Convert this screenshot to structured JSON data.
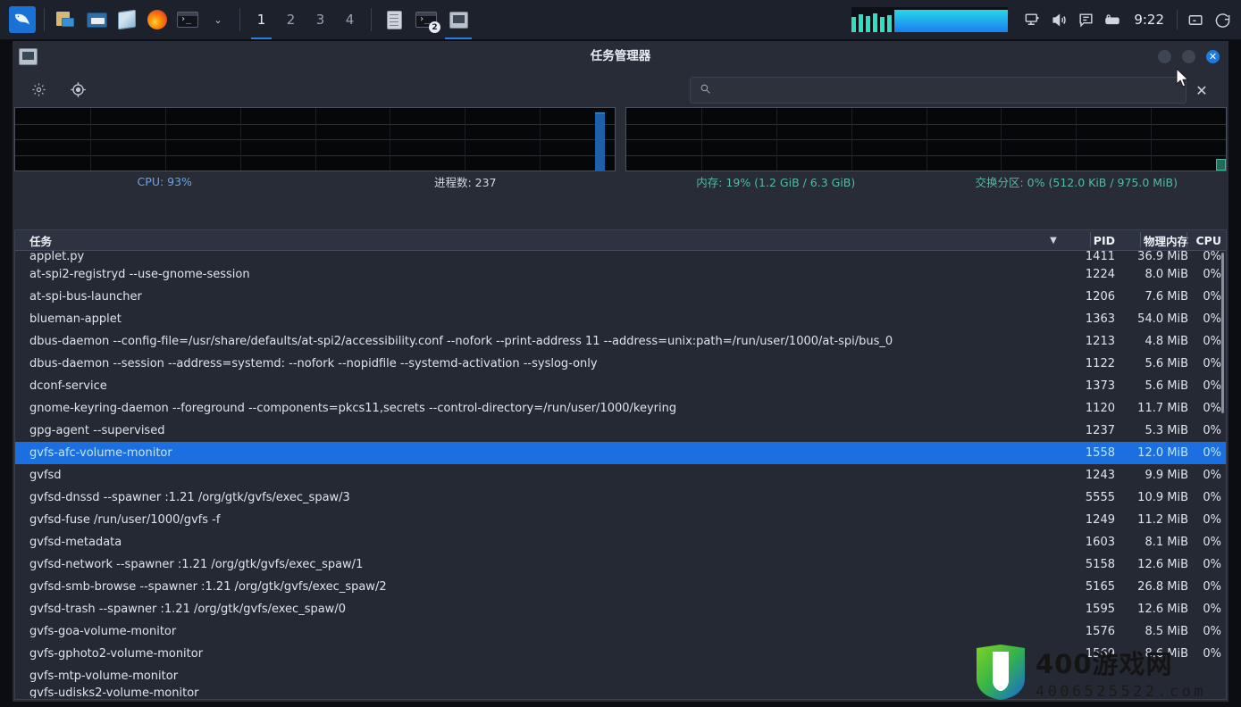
{
  "taskbar": {
    "launcher": {
      "name": "kali-menu",
      "label": ""
    },
    "pinned": [
      {
        "icon": "files-split-icon",
        "label": ""
      },
      {
        "icon": "folder-icon",
        "label": ""
      },
      {
        "icon": "notes-app-icon",
        "label": ""
      },
      {
        "icon": "firefox-icon",
        "label": ""
      },
      {
        "icon": "terminal-icon",
        "label": ""
      }
    ],
    "dropdown_caret": "⌄",
    "desktops": [
      {
        "label": "1",
        "active": true
      },
      {
        "label": "2",
        "active": false
      },
      {
        "label": "3",
        "active": false
      },
      {
        "label": "4",
        "active": false
      }
    ],
    "tasks": [
      {
        "icon": "text-editor-icon",
        "badge": "",
        "active": false
      },
      {
        "icon": "terminal-window-icon",
        "badge": "2",
        "active": false
      },
      {
        "icon": "task-manager-icon",
        "badge": "",
        "active": true
      }
    ],
    "tray": [
      {
        "icon": "display-icon"
      },
      {
        "icon": "volume-icon"
      },
      {
        "icon": "chat-icon"
      },
      {
        "icon": "keyboard-icon"
      }
    ],
    "clock": "9:22",
    "tray_right": [
      {
        "icon": "screen-lock-icon"
      },
      {
        "icon": "power-icon"
      }
    ],
    "cpu_widget_name": "cpu-monitor-widget"
  },
  "window": {
    "title": "任务管理器",
    "icon": "task-manager-icon",
    "buttons": {
      "minimize": "",
      "maximize": "",
      "close": "✕"
    },
    "toolbar": {
      "settings_icon": "gear-icon",
      "target_icon": "crosshair-icon"
    },
    "search": {
      "icon": "search-icon",
      "value": "",
      "placeholder": "",
      "clear_label": "✕"
    }
  },
  "stats": {
    "cpu_label": "CPU: 93%",
    "process_label": "进程数: 237",
    "memory_label": "内存: 19% (1.2 GiB / 6.3 GiB)",
    "swap_label": "交换分区: 0% (512.0 KiB / 975.0 MiB)"
  },
  "chart_data": [
    {
      "type": "area",
      "title": "CPU",
      "ylabel": "%",
      "ylim": [
        0,
        100
      ],
      "grid": true,
      "series": [
        {
          "name": "CPU",
          "color": "#1d5fa8",
          "values": [
            0,
            0,
            0,
            0,
            0,
            0,
            0,
            0,
            0,
            0,
            0,
            0,
            0,
            0,
            0,
            0,
            0,
            0,
            0,
            0,
            0,
            0,
            0,
            0,
            0,
            0,
            0,
            0,
            0,
            0,
            0,
            0,
            0,
            0,
            0,
            0,
            0,
            0,
            0,
            0,
            0,
            0,
            0,
            0,
            0,
            0,
            0,
            0,
            0,
            0,
            0,
            0,
            0,
            0,
            0,
            0,
            0,
            0,
            0,
            93,
            0
          ]
        }
      ],
      "annotation": "CPU: 93%"
    },
    {
      "type": "area",
      "title": "内存",
      "ylabel": "%",
      "ylim": [
        0,
        100
      ],
      "grid": true,
      "series": [
        {
          "name": "内存",
          "color": "#1f6b5c",
          "values": [
            0,
            0,
            0,
            0,
            0,
            0,
            0,
            0,
            0,
            0,
            0,
            0,
            0,
            0,
            0,
            0,
            0,
            0,
            0,
            0,
            0,
            0,
            0,
            0,
            0,
            0,
            0,
            0,
            0,
            0,
            0,
            0,
            0,
            0,
            0,
            0,
            0,
            0,
            0,
            0,
            0,
            0,
            0,
            0,
            0,
            0,
            0,
            0,
            0,
            0,
            0,
            0,
            0,
            0,
            0,
            0,
            0,
            0,
            0,
            0,
            19
          ]
        }
      ],
      "annotation": "内存: 19% (1.2 GiB / 6.3 GiB)"
    }
  ],
  "table": {
    "headers": {
      "task": "任务",
      "sort_icon": "▼",
      "pid": "PID",
      "memory": "物理内存",
      "cpu": "CPU"
    },
    "rows": [
      {
        "task": "applet.py",
        "pid": "1411",
        "mem": "36.9 MiB",
        "cpu": "0%",
        "selected": false,
        "clipped": "top"
      },
      {
        "task": "at-spi2-registryd --use-gnome-session",
        "pid": "1224",
        "mem": "8.0 MiB",
        "cpu": "0%",
        "selected": false
      },
      {
        "task": "at-spi-bus-launcher",
        "pid": "1206",
        "mem": "7.6 MiB",
        "cpu": "0%",
        "selected": false
      },
      {
        "task": "blueman-applet",
        "pid": "1363",
        "mem": "54.0 MiB",
        "cpu": "0%",
        "selected": false
      },
      {
        "task": "dbus-daemon --config-file=/usr/share/defaults/at-spi2/accessibility.conf --nofork --print-address 11 --address=unix:path=/run/user/1000/at-spi/bus_0",
        "pid": "1213",
        "mem": "4.8 MiB",
        "cpu": "0%",
        "selected": false
      },
      {
        "task": "dbus-daemon --session --address=systemd: --nofork --nopidfile --systemd-activation --syslog-only",
        "pid": "1122",
        "mem": "5.6 MiB",
        "cpu": "0%",
        "selected": false
      },
      {
        "task": "dconf-service",
        "pid": "1373",
        "mem": "5.6 MiB",
        "cpu": "0%",
        "selected": false
      },
      {
        "task": "gnome-keyring-daemon --foreground --components=pkcs11,secrets --control-directory=/run/user/1000/keyring",
        "pid": "1120",
        "mem": "11.7 MiB",
        "cpu": "0%",
        "selected": false
      },
      {
        "task": "gpg-agent --supervised",
        "pid": "1237",
        "mem": "5.3 MiB",
        "cpu": "0%",
        "selected": false
      },
      {
        "task": "gvfs-afc-volume-monitor",
        "pid": "1558",
        "mem": "12.0 MiB",
        "cpu": "0%",
        "selected": true
      },
      {
        "task": "gvfsd",
        "pid": "1243",
        "mem": "9.9 MiB",
        "cpu": "0%",
        "selected": false
      },
      {
        "task": "gvfsd-dnssd --spawner :1.21 /org/gtk/gvfs/exec_spaw/3",
        "pid": "5555",
        "mem": "10.9 MiB",
        "cpu": "0%",
        "selected": false
      },
      {
        "task": "gvfsd-fuse /run/user/1000/gvfs -f",
        "pid": "1249",
        "mem": "11.2 MiB",
        "cpu": "0%",
        "selected": false
      },
      {
        "task": "gvfsd-metadata",
        "pid": "1603",
        "mem": "8.1 MiB",
        "cpu": "0%",
        "selected": false
      },
      {
        "task": "gvfsd-network --spawner :1.21 /org/gtk/gvfs/exec_spaw/1",
        "pid": "5158",
        "mem": "12.6 MiB",
        "cpu": "0%",
        "selected": false
      },
      {
        "task": "gvfsd-smb-browse --spawner :1.21 /org/gtk/gvfs/exec_spaw/2",
        "pid": "5165",
        "mem": "26.8 MiB",
        "cpu": "0%",
        "selected": false
      },
      {
        "task": "gvfsd-trash --spawner :1.21 /org/gtk/gvfs/exec_spaw/0",
        "pid": "1595",
        "mem": "12.6 MiB",
        "cpu": "0%",
        "selected": false
      },
      {
        "task": "gvfs-goa-volume-monitor",
        "pid": "1576",
        "mem": "8.5 MiB",
        "cpu": "0%",
        "selected": false
      },
      {
        "task": "gvfs-gphoto2-volume-monitor",
        "pid": "1569",
        "mem": "8.6 MiB",
        "cpu": "0%",
        "selected": false
      },
      {
        "task": "gvfs-mtp-volume-monitor",
        "pid": "",
        "mem": "",
        "cpu": "",
        "selected": false
      },
      {
        "task": "gvfs-udisks2-volume-monitor",
        "pid": "",
        "mem": "",
        "cpu": "",
        "selected": false,
        "clipped": "bottom"
      }
    ]
  },
  "watermark": {
    "chinese": "400游戏网",
    "domain": "4006525522.com"
  },
  "colors": {
    "accent_blue": "#1c6fe0",
    "cpu_line": "#6aa4e8",
    "mem_line": "#57b89f",
    "window_bg": "#272c36",
    "taskbar_bg": "#1c212b"
  }
}
